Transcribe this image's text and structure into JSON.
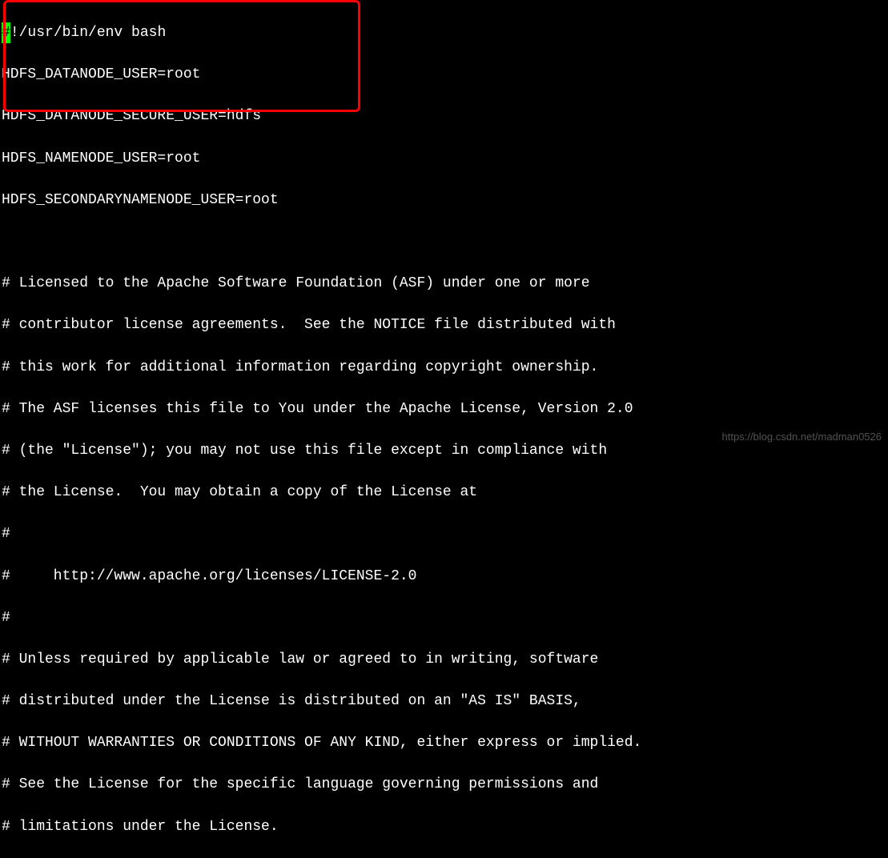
{
  "shebang": {
    "cursor_char": "#",
    "rest": "!/usr/bin/env bash"
  },
  "config_lines": [
    "HDFS_DATANODE_USER=root",
    "HDFS_DATANODE_SECURE_USER=hdfs",
    "HDFS_NAMENODE_USER=root",
    "HDFS_SECONDARYNAMENODE_USER=root"
  ],
  "license_lines": [
    "",
    "",
    "# Licensed to the Apache Software Foundation (ASF) under one or more",
    "# contributor license agreements.  See the NOTICE file distributed with",
    "# this work for additional information regarding copyright ownership.",
    "# The ASF licenses this file to You under the Apache License, Version 2.0",
    "# (the \"License\"); you may not use this file except in compliance with",
    "# the License.  You may obtain a copy of the License at",
    "#",
    "#     http://www.apache.org/licenses/LICENSE-2.0",
    "#",
    "# Unless required by applicable law or agreed to in writing, software",
    "# distributed under the License is distributed on an \"AS IS\" BASIS,",
    "# WITHOUT WARRANTIES OR CONDITIONS OF ANY KIND, either express or implied.",
    "# See the License for the specific language governing permissions and",
    "# limitations under the License."
  ],
  "watermark": "https://blog.csdn.net/madman0526"
}
